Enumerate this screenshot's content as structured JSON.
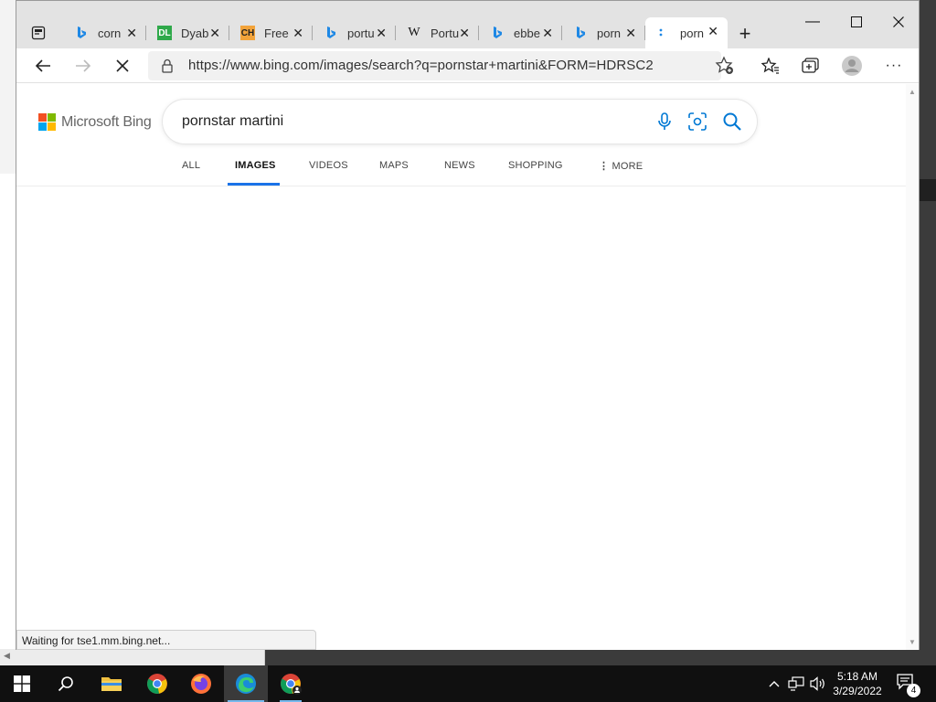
{
  "browser": {
    "tabs": [
      {
        "title": "corn",
        "icon": "bing-icon"
      },
      {
        "title": "Dyab",
        "icon": "dl-icon",
        "icon_text": "DL"
      },
      {
        "title": "Free",
        "icon": "ch-icon",
        "icon_text": "CH"
      },
      {
        "title": "portu",
        "icon": "bing-icon"
      },
      {
        "title": "Portu",
        "icon": "wikipedia-icon",
        "icon_text": "W"
      },
      {
        "title": "ebbe",
        "icon": "bing-icon"
      },
      {
        "title": "porn",
        "icon": "bing-icon"
      },
      {
        "title": "porn",
        "icon": "loading-icon",
        "active": true
      }
    ],
    "url": "https://www.bing.com/images/search?q=pornstar+martini&FORM=HDRSC2",
    "status": "Waiting for tse1.mm.bing.net..."
  },
  "bing": {
    "logo_text": "Microsoft Bing",
    "query": "pornstar martini",
    "scopes": [
      {
        "label": "ALL"
      },
      {
        "label": "IMAGES",
        "active": true
      },
      {
        "label": "VIDEOS"
      },
      {
        "label": "MAPS"
      },
      {
        "label": "NEWS"
      },
      {
        "label": "SHOPPING"
      },
      {
        "label": "MORE"
      }
    ]
  },
  "taskbar": {
    "apps": [
      "start",
      "search",
      "file-explorer",
      "chrome",
      "firefox",
      "edge",
      "chrome-profile"
    ],
    "time": "5:18 AM",
    "date": "3/29/2022",
    "notification_count": "4"
  },
  "colors": {
    "accent": "#1a73e8",
    "bing_blue": "#0078d4",
    "taskbar": "#101010"
  }
}
